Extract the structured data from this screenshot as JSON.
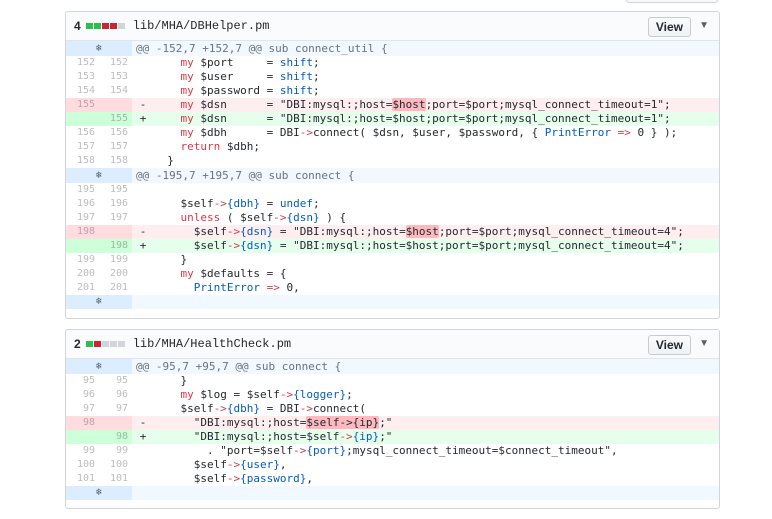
{
  "files": [
    {
      "count": "4",
      "path": "lib/MHA/DBHelper.pm",
      "view_label": "View",
      "rows": [
        {
          "type": "hunk",
          "code": "@@ -152,7 +152,7 @@ sub connect_util {"
        },
        {
          "type": "ctx",
          "old": "152",
          "new": "152",
          "code": "    my $port     = shift;"
        },
        {
          "type": "ctx",
          "old": "153",
          "new": "153",
          "code": "    my $user     = shift;"
        },
        {
          "type": "ctx",
          "old": "154",
          "new": "154",
          "code": "    my $password = shift;"
        },
        {
          "type": "del",
          "old": "155",
          "new": "",
          "code": "    my $dsn      = \"DBI:mysql:;host=[$host];port=$port;mysql_connect_timeout=1\";"
        },
        {
          "type": "add",
          "old": "",
          "new": "155",
          "code": "    my $dsn      = \"DBI:mysql:;host=$host;port=$port;mysql_connect_timeout=1\";"
        },
        {
          "type": "ctx",
          "old": "156",
          "new": "156",
          "code": "    my $dbh      = DBI->connect( $dsn, $user, $password, { PrintError => 0 } );"
        },
        {
          "type": "ctx",
          "old": "157",
          "new": "157",
          "code": "    return $dbh;"
        },
        {
          "type": "ctx",
          "old": "158",
          "new": "158",
          "code": "  }"
        },
        {
          "type": "hunk",
          "code": "@@ -195,7 +195,7 @@ sub connect {"
        },
        {
          "type": "ctx",
          "old": "195",
          "new": "195",
          "code": ""
        },
        {
          "type": "ctx",
          "old": "196",
          "new": "196",
          "code": "    $self->{dbh} = undef;"
        },
        {
          "type": "ctx",
          "old": "197",
          "new": "197",
          "code": "    unless ( $self->{dsn} ) {"
        },
        {
          "type": "del",
          "old": "198",
          "new": "",
          "code": "      $self->{dsn} = \"DBI:mysql:;host=[$host];port=$port;mysql_connect_timeout=4\";"
        },
        {
          "type": "add",
          "old": "",
          "new": "198",
          "code": "      $self->{dsn} = \"DBI:mysql:;host=$host;port=$port;mysql_connect_timeout=4\";"
        },
        {
          "type": "ctx",
          "old": "199",
          "new": "199",
          "code": "    }"
        },
        {
          "type": "ctx",
          "old": "200",
          "new": "200",
          "code": "    my $defaults = {"
        },
        {
          "type": "ctx",
          "old": "201",
          "new": "201",
          "code": "      PrintError => 0,"
        },
        {
          "type": "spacer",
          "code": ""
        }
      ]
    },
    {
      "count": "2",
      "path": "lib/MHA/HealthCheck.pm",
      "view_label": "View",
      "rows": [
        {
          "type": "hunk",
          "code": "@@ -95,7 +95,7 @@ sub connect {"
        },
        {
          "type": "ctx",
          "old": "95",
          "new": "95",
          "code": "    }"
        },
        {
          "type": "ctx",
          "old": "96",
          "new": "96",
          "code": "    my $log = $self->{logger};"
        },
        {
          "type": "ctx",
          "old": "97",
          "new": "97",
          "code": "    $self->{dbh} = DBI->connect("
        },
        {
          "type": "del",
          "old": "98",
          "new": "",
          "code": "      \"DBI:mysql:;host=[$self->{ip}];\""
        },
        {
          "type": "add",
          "old": "",
          "new": "98",
          "code": "      \"DBI:mysql:;host=$self->{ip};\""
        },
        {
          "type": "ctx",
          "old": "99",
          "new": "99",
          "code": "        . \"port=$self->{port};mysql_connect_timeout=$connect_timeout\","
        },
        {
          "type": "ctx",
          "old": "100",
          "new": "100",
          "code": "      $self->{user},"
        },
        {
          "type": "ctx",
          "old": "101",
          "new": "101",
          "code": "      $self->{password},"
        },
        {
          "type": "spacer",
          "code": ""
        }
      ]
    }
  ]
}
